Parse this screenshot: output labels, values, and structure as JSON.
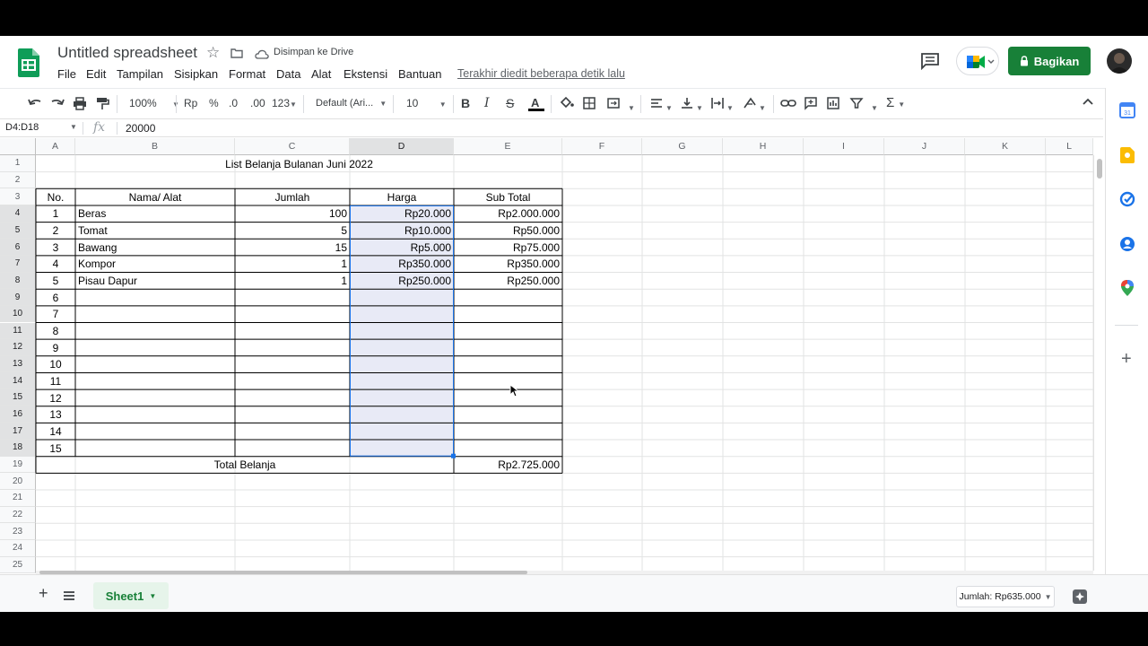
{
  "header": {
    "doc_title": "Untitled spreadsheet",
    "save_status": "Disimpan ke Drive",
    "last_edit": "Terakhir diedit beberapa detik lalu",
    "share_label": "Bagikan"
  },
  "menu": [
    "File",
    "Edit",
    "Tampilan",
    "Sisipkan",
    "Format",
    "Data",
    "Alat",
    "Ekstensi",
    "Bantuan"
  ],
  "toolbar": {
    "zoom": "100%",
    "currency": "Rp",
    "percent": "%",
    "dec_less": ".0",
    "dec_more": ".00",
    "num_format": "123",
    "font": "Default (Ari...",
    "font_size": "10"
  },
  "formula_bar": {
    "name_box": "D4:D18",
    "fx": "fx",
    "formula": "20000"
  },
  "columns": [
    "A",
    "B",
    "C",
    "D",
    "E",
    "F",
    "G",
    "H",
    "I",
    "J",
    "K",
    "L"
  ],
  "rows": [
    "1",
    "2",
    "3",
    "4",
    "5",
    "6",
    "7",
    "8",
    "9",
    "10",
    "11",
    "12",
    "13",
    "14",
    "15",
    "16",
    "17",
    "18",
    "19",
    "20",
    "21",
    "22",
    "23",
    "24",
    "25"
  ],
  "sheet": {
    "title": "List Belanja Bulanan Juni 2022",
    "headers": {
      "no": "No.",
      "name": "Nama/ Alat",
      "qty": "Jumlah",
      "price": "Harga",
      "subtotal": "Sub Total"
    },
    "items": [
      {
        "no": "1",
        "name": "Beras",
        "qty": "100",
        "price": "Rp20.000",
        "subtotal": "Rp2.000.000"
      },
      {
        "no": "2",
        "name": "Tomat",
        "qty": "5",
        "price": "Rp10.000",
        "subtotal": "Rp50.000"
      },
      {
        "no": "3",
        "name": "Bawang",
        "qty": "15",
        "price": "Rp5.000",
        "subtotal": "Rp75.000"
      },
      {
        "no": "4",
        "name": "Kompor",
        "qty": "1",
        "price": "Rp350.000",
        "subtotal": "Rp350.000"
      },
      {
        "no": "5",
        "name": "Pisau Dapur",
        "qty": "1",
        "price": "Rp250.000",
        "subtotal": "Rp250.000"
      },
      {
        "no": "6",
        "name": "",
        "qty": "",
        "price": "",
        "subtotal": ""
      },
      {
        "no": "7",
        "name": "",
        "qty": "",
        "price": "",
        "subtotal": ""
      },
      {
        "no": "8",
        "name": "",
        "qty": "",
        "price": "",
        "subtotal": ""
      },
      {
        "no": "9",
        "name": "",
        "qty": "",
        "price": "",
        "subtotal": ""
      },
      {
        "no": "10",
        "name": "",
        "qty": "",
        "price": "",
        "subtotal": ""
      },
      {
        "no": "11",
        "name": "",
        "qty": "",
        "price": "",
        "subtotal": ""
      },
      {
        "no": "12",
        "name": "",
        "qty": "",
        "price": "",
        "subtotal": ""
      },
      {
        "no": "13",
        "name": "",
        "qty": "",
        "price": "",
        "subtotal": ""
      },
      {
        "no": "14",
        "name": "",
        "qty": "",
        "price": "",
        "subtotal": ""
      },
      {
        "no": "15",
        "name": "",
        "qty": "",
        "price": "",
        "subtotal": ""
      }
    ],
    "total_label": "Total Belanja",
    "total_value": "Rp2.725.000"
  },
  "bottom": {
    "sheet_tab": "Sheet1",
    "sum": "Jumlah: Rp635.000"
  },
  "colors": {
    "accent_green": "#188038",
    "selection": "#e8eaf6",
    "selection_border": "#1a73e8"
  }
}
